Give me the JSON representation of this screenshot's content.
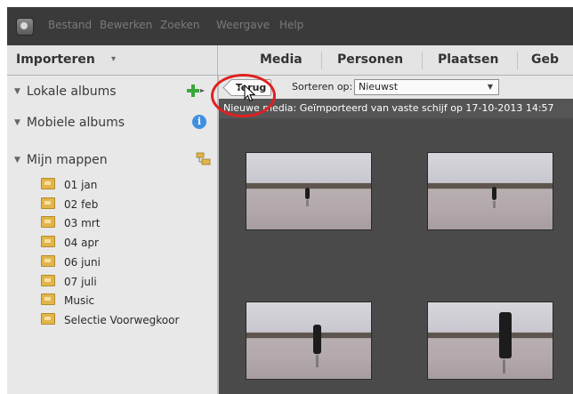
{
  "menu": {
    "items": [
      "Bestand",
      "Bewerken",
      "Zoeken",
      "Weergave",
      "Help"
    ]
  },
  "topbar": {
    "importeren_label": "Importeren",
    "tabs": [
      "Media",
      "Personen",
      "Plaatsen",
      "Geb"
    ]
  },
  "sidebar": {
    "sections": [
      "Lokale albums",
      "Mobiele albums",
      "Mijn mappen"
    ],
    "folders": [
      "01 jan",
      "02 feb",
      "03 mrt",
      "04 apr",
      "06 juni",
      "07 juli",
      "Music",
      "Selectie Voorwegkoor"
    ]
  },
  "content": {
    "back_label": "Terug",
    "sort_label": "Sorteren op:",
    "sort_value": "Nieuwst",
    "info_text": "Nieuwe media: Geïmporteerd van vaste schijf op 17-10-2013 14:57"
  },
  "colors": {
    "highlight": "#e02020",
    "accent_green": "#3aa83a",
    "info_blue": "#3f8fe0"
  },
  "icons": [
    "app-logo-icon",
    "add-album-icon",
    "info-icon",
    "folder-icon",
    "cursor-icon"
  ]
}
